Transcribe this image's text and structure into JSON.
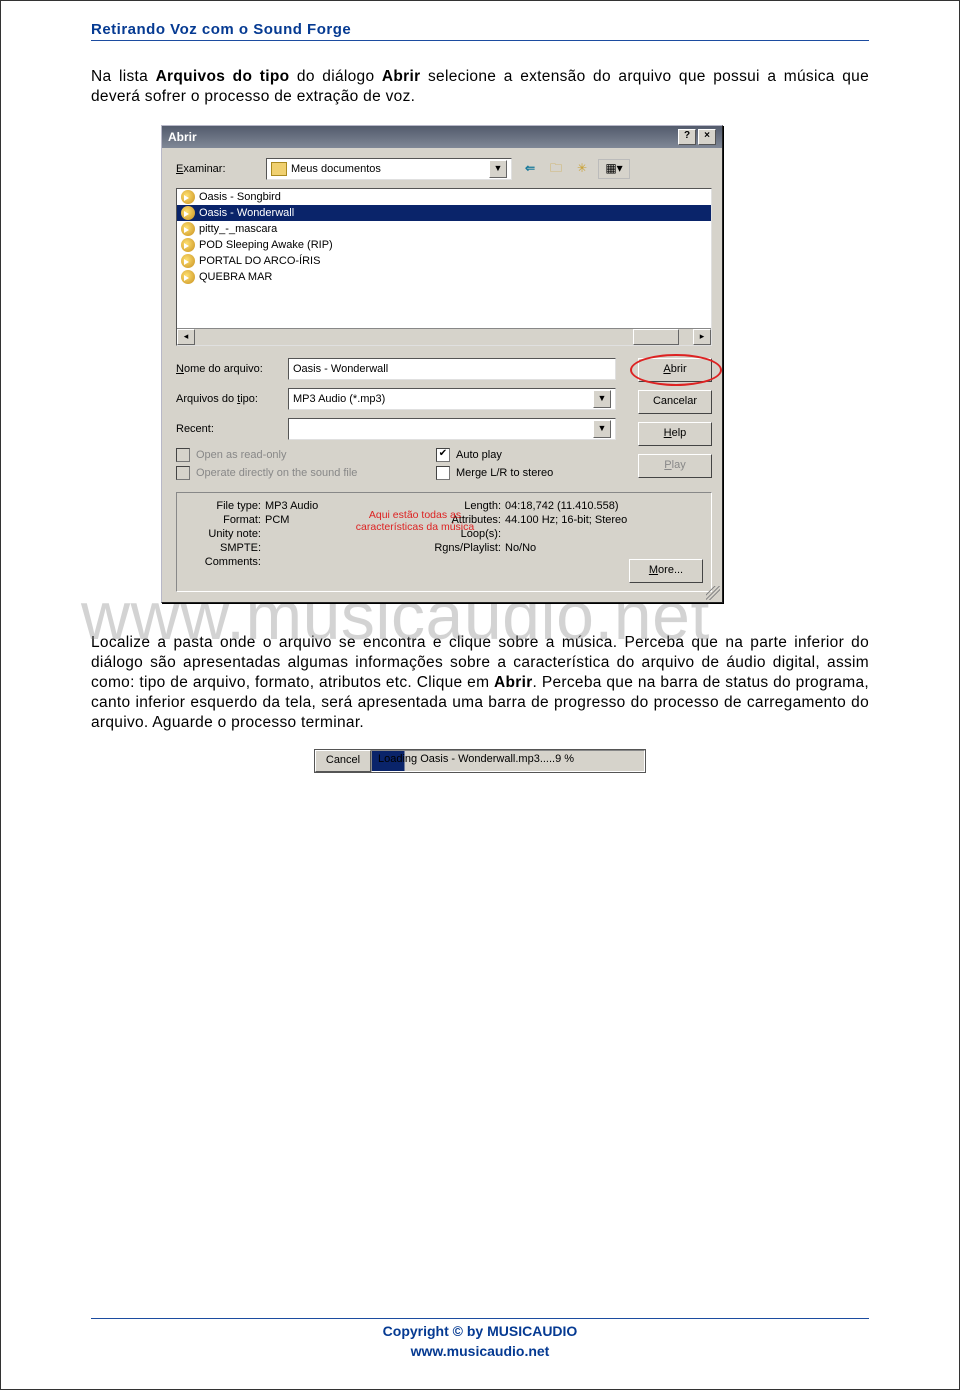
{
  "header": {
    "title": "Retirando Voz com o Sound Forge"
  },
  "para1_parts": {
    "a": "Na lista ",
    "b": "Arquivos do tipo",
    "c": " do diálogo ",
    "d": "Abrir",
    "e": " selecione a extensão do arquivo que possui a música que deverá sofrer o processo de extração de voz."
  },
  "dialog": {
    "title": "Abrir",
    "help_btn": "?",
    "close_btn": "×",
    "examinar_label": "Examinar:",
    "examinar_value": "Meus documentos",
    "toolbar_icons": {
      "back": "⇐",
      "up": "🗀",
      "newfolder": "✳",
      "view": "▦▾"
    },
    "files": [
      "Oasis - Songbird",
      "Oasis - Wonderwall",
      "pitty_-_mascara",
      "POD Sleeping Awake (RIP)",
      "PORTAL DO ARCO-ÍRIS",
      "QUEBRA MAR"
    ],
    "selected_index": 1,
    "hscroll_left": "◂",
    "hscroll_right": "▸",
    "nome_label": "Nome do arquivo:",
    "nome_value": "Oasis - Wonderwall",
    "tipo_label": "Arquivos do tipo:",
    "tipo_value": "MP3 Audio (*.mp3)",
    "recent_label": "Recent:",
    "recent_value": "",
    "open_ro": "Open as read-only",
    "operate": "Operate directly on the sound file",
    "autoplay": "Auto play",
    "merge": "Merge L/R to stereo",
    "btn_abrir": "Abrir",
    "btn_cancelar": "Cancelar",
    "btn_help": "Help",
    "btn_play": "Play",
    "info": {
      "file_type_k": "File type:",
      "file_type_v": "MP3 Audio",
      "format_k": "Format:",
      "format_v": "PCM",
      "unity_k": "Unity note:",
      "unity_v": "",
      "smpte_k": "SMPTE:",
      "smpte_v": "",
      "comments_k": "Comments:",
      "comments_v": "",
      "length_k": "Length:",
      "length_v": "04:18,742 (11.410.558)",
      "attr_k": "Attributes:",
      "attr_v": "44.100 Hz; 16-bit; Stereo",
      "loops_k": "Loop(s):",
      "loops_v": "",
      "rgns_k": "Rgns/Playlist:",
      "rgns_v": "No/No",
      "more_btn": "More..."
    },
    "red_note": "Aqui estão todas as características da música"
  },
  "para2_parts": {
    "a": "Localize a pasta onde o arquivo se encontra e clique sobre a música. Perceba que na parte inferior do diálogo são apresentadas algumas informações sobre a característica do arquivo de áudio digital, assim como: tipo de arquivo, formato, atributos etc. Clique em ",
    "b": "Abrir",
    "c": ". Perceba que na barra de status do programa, canto inferior esquerdo da tela, será apresentada uma barra de progresso do processo de carregamento do arquivo. Aguarde o processo terminar."
  },
  "statusbar": {
    "cancel": "Cancel",
    "msg": "Loading Oasis - Wonderwall.mp3.....9 %"
  },
  "footer": {
    "l1": "Copyright © by MUSICAUDIO",
    "l2": "www.musicaudio.net"
  }
}
